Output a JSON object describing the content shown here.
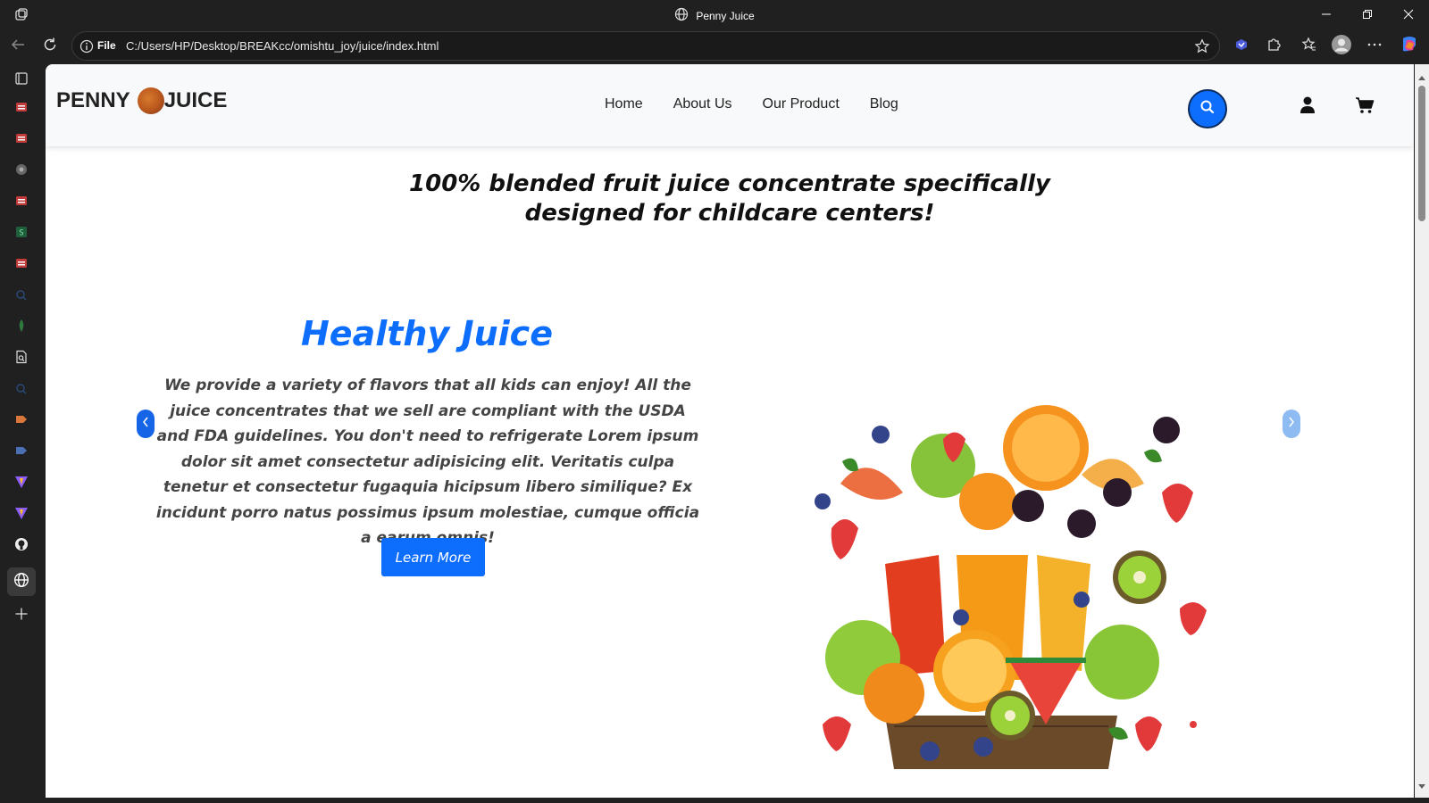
{
  "window": {
    "title": "Penny Juice",
    "controls": [
      "minimize-icon",
      "restore-icon",
      "close-icon"
    ]
  },
  "toolbar": {
    "scheme_label": "File",
    "url": "C:/Users/HP/Desktop/BREAKcc/omishtu_joy/juice/index.html"
  },
  "sidebar": {
    "icons": [
      "tab-actions-icon",
      "pdf-icon",
      "pdf-icon",
      "app-icon",
      "pdf-icon",
      "sheets-icon",
      "pdf-icon",
      "search-icon",
      "mongodb-icon",
      "file-search-icon",
      "search-icon",
      "tag-icon",
      "tag-icon",
      "vite-icon",
      "vite-icon",
      "github-icon",
      "globe-icon",
      "add-icon"
    ]
  },
  "site": {
    "logo_left": "PENNY",
    "logo_right": "JUICE",
    "nav": [
      "Home",
      "About Us",
      "Our Product",
      "Blog"
    ],
    "tagline_line1": "100% blended fruit juice concentrate specifically",
    "tagline_line2": "designed for childcare centers!",
    "hero_title": "Healthy Juice",
    "hero_text": "We provide a variety of flavors that all kids can enjoy! All the juice concentrates that we sell are compliant with the USDA and FDA guidelines. You don't need to refrigerate Lorem ipsum dolor sit amet consectetur adipisicing elit. Veritatis culpa tenetur et consectetur fugaquia hicipsum libero similique? Ex incidunt porro natus possimus ipsum molestiae, cumque officia a earum omnis!",
    "learn_more": "Learn More"
  },
  "colors": {
    "accent": "#0d6efd",
    "header_bg": "#f8f9fa",
    "chrome_bg": "#202020"
  }
}
